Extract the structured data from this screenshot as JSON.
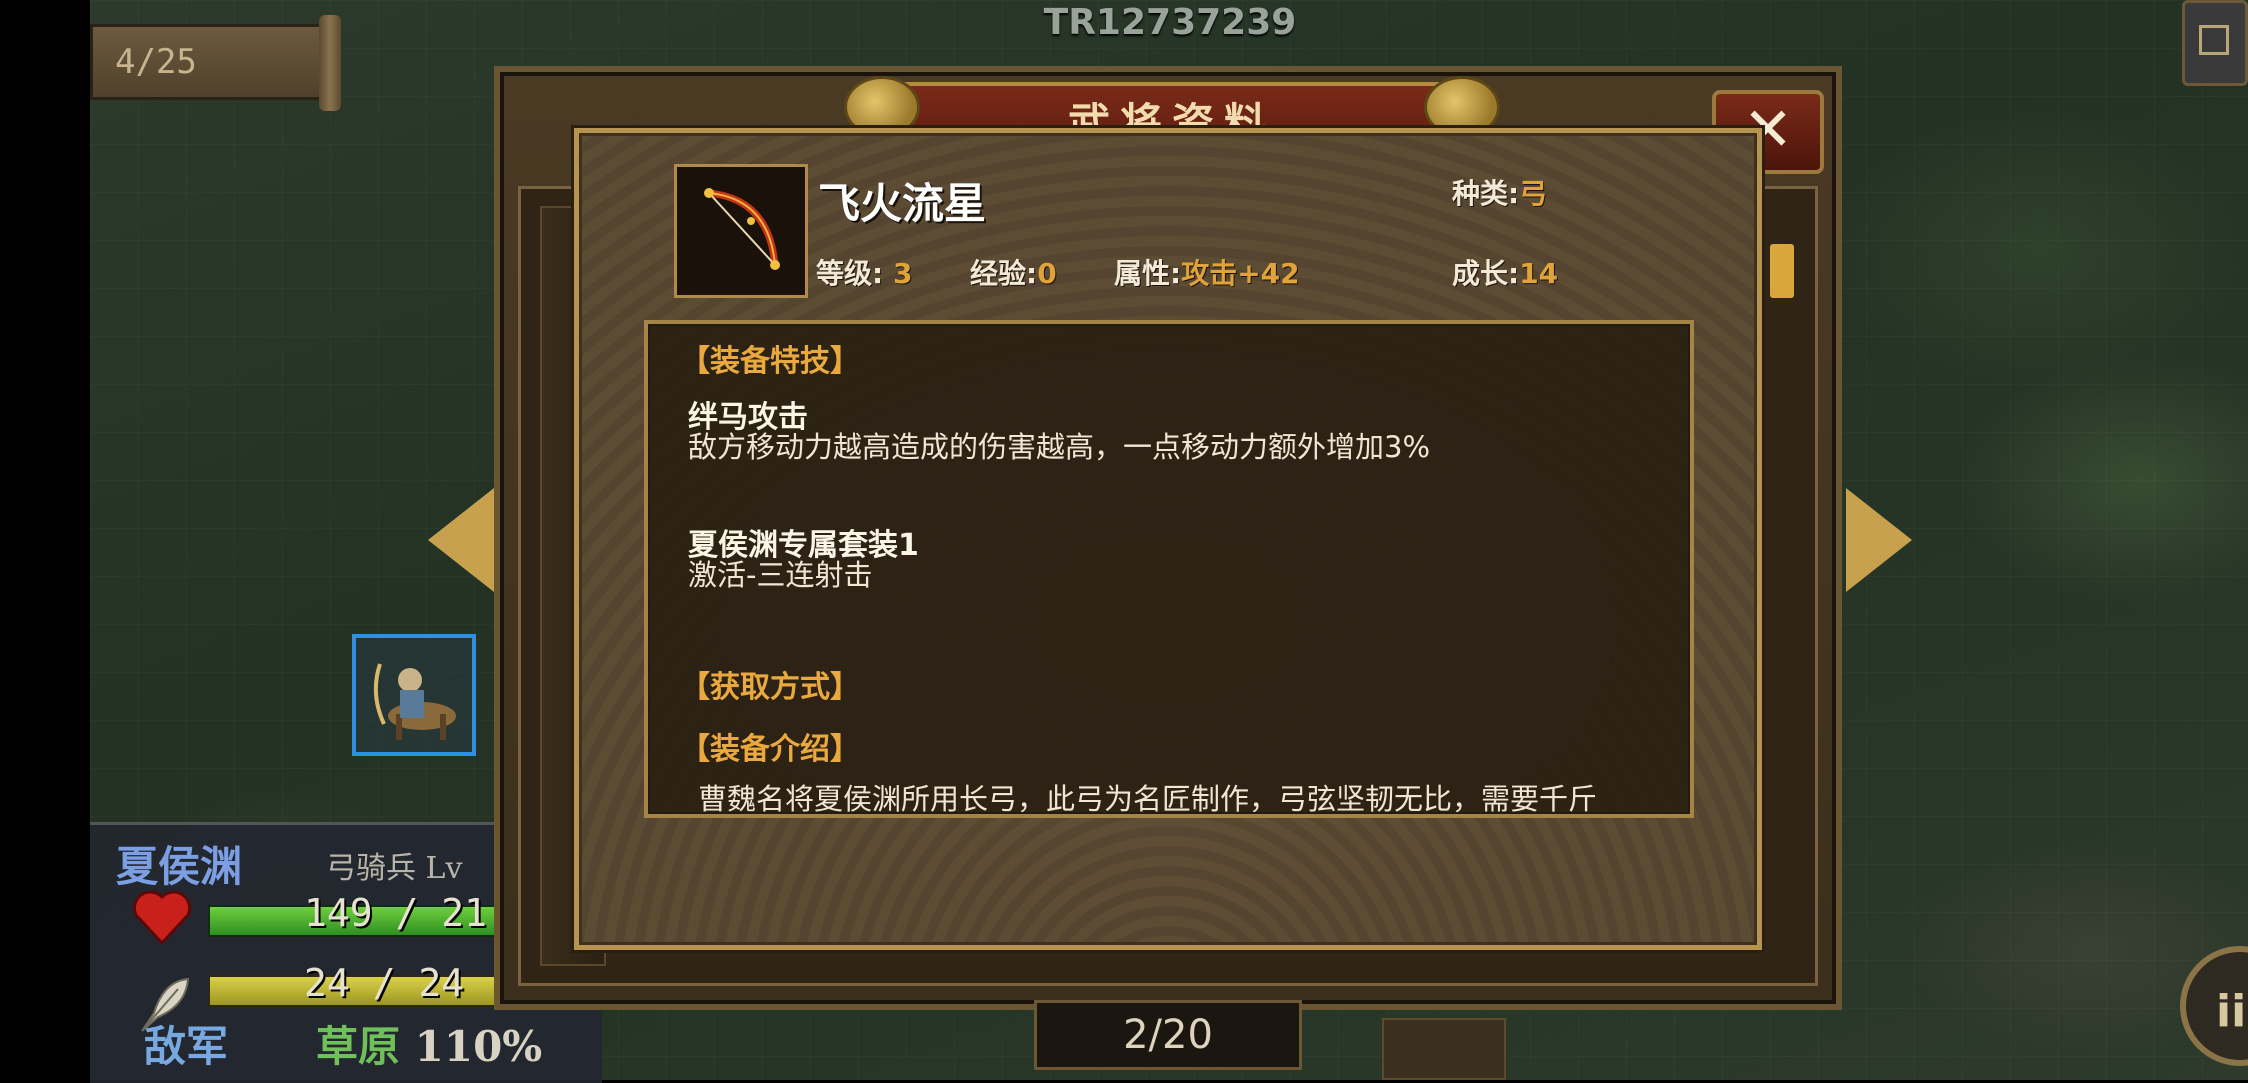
{
  "hud": {
    "battle_id": "TR12737239",
    "turn_counter": "4/25",
    "menu_glyph": "ii"
  },
  "unit_panel": {
    "name": "夏侯渊",
    "class_level": "弓骑兵 Lv ",
    "hp_text": "149 / 21",
    "hp_fraction": 0.71,
    "mp_text": "24 / 24",
    "mp_fraction": 1.0,
    "side": "敌军",
    "terrain": "草原",
    "terrain_bonus": "110%"
  },
  "back_dialog": {
    "title": "武将资料",
    "close_glyph": "✕",
    "page_indicator": "2/20"
  },
  "equipment": {
    "icon": "bow-icon",
    "name": "飞火流星",
    "type_label": "种类:",
    "type_value": "弓",
    "level_label": "等级:",
    "level_value": "3",
    "exp_label": "经验:",
    "exp_value": "0",
    "attr_label": "属性:",
    "attr_value": "攻击+42",
    "growth_label": "成长:",
    "growth_value": "14",
    "sections": {
      "skill_title": "【装备特技】",
      "skill_1_name": "绊马攻击",
      "skill_1_desc": "敌方移动力越高造成的伤害越高，一点移动力额外增加3%",
      "skill_2_name": "夏侯渊专属套装1",
      "skill_2_desc": "激活-三连射击",
      "source_title": "【获取方式】",
      "intro_title": "【装备介绍】",
      "intro_text": "曹魏名将夏侯渊所用长弓，此弓为名匠制作，弓弦坚韧无比，需要千斤"
    }
  },
  "colors": {
    "accent_gold": "#e0a33a",
    "section_orange": "#e9a93e",
    "hp_green": "#2f8e22",
    "mp_yellow": "#9c9622",
    "enemy_blue": "#78a8e0"
  }
}
